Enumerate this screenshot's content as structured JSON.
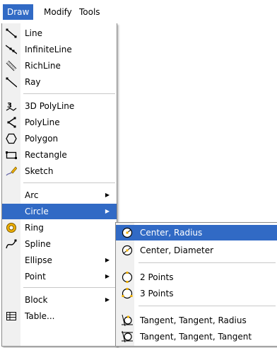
{
  "menubar": {
    "items": [
      "Draw",
      "Modify",
      "Tools"
    ]
  },
  "draw_menu": {
    "items": [
      {
        "label": "Line",
        "icon": "line-icon"
      },
      {
        "label": "InfiniteLine",
        "icon": "infinite-line-icon"
      },
      {
        "label": "RichLine",
        "icon": "rich-line-icon"
      },
      {
        "label": "Ray",
        "icon": "ray-icon"
      },
      {
        "label": "3D PolyLine",
        "icon": "3d-polyline-icon"
      },
      {
        "label": "PolyLine",
        "icon": "polyline-icon"
      },
      {
        "label": "Polygon",
        "icon": "polygon-icon"
      },
      {
        "label": "Rectangle",
        "icon": "rectangle-icon"
      },
      {
        "label": "Sketch",
        "icon": "sketch-icon"
      },
      {
        "label": "Arc",
        "icon": "",
        "submenu": true
      },
      {
        "label": "Circle",
        "icon": "",
        "submenu": true,
        "highlighted": true
      },
      {
        "label": "Ring",
        "icon": "ring-icon"
      },
      {
        "label": "Spline",
        "icon": "spline-icon"
      },
      {
        "label": "Ellipse",
        "icon": "",
        "submenu": true
      },
      {
        "label": "Point",
        "icon": "",
        "submenu": true
      },
      {
        "label": "Block",
        "icon": "",
        "submenu": true
      },
      {
        "label": "Table...",
        "icon": "table-icon"
      }
    ]
  },
  "circle_submenu": {
    "items": [
      {
        "label": "Center, Radius",
        "icon": "circle-center-radius-icon",
        "highlighted": true
      },
      {
        "label": "Center, Diameter",
        "icon": "circle-center-diameter-icon"
      },
      {
        "label": "2 Points",
        "icon": "circle-2-points-icon"
      },
      {
        "label": "3 Points",
        "icon": "circle-3-points-icon"
      },
      {
        "label": "Tangent, Tangent, Radius",
        "icon": "circle-ttr-icon"
      },
      {
        "label": "Tangent, Tangent, Tangent",
        "icon": "circle-ttt-icon"
      }
    ]
  },
  "colors": {
    "highlight": "#316ac5",
    "accent_yellow": "#f0b000"
  }
}
